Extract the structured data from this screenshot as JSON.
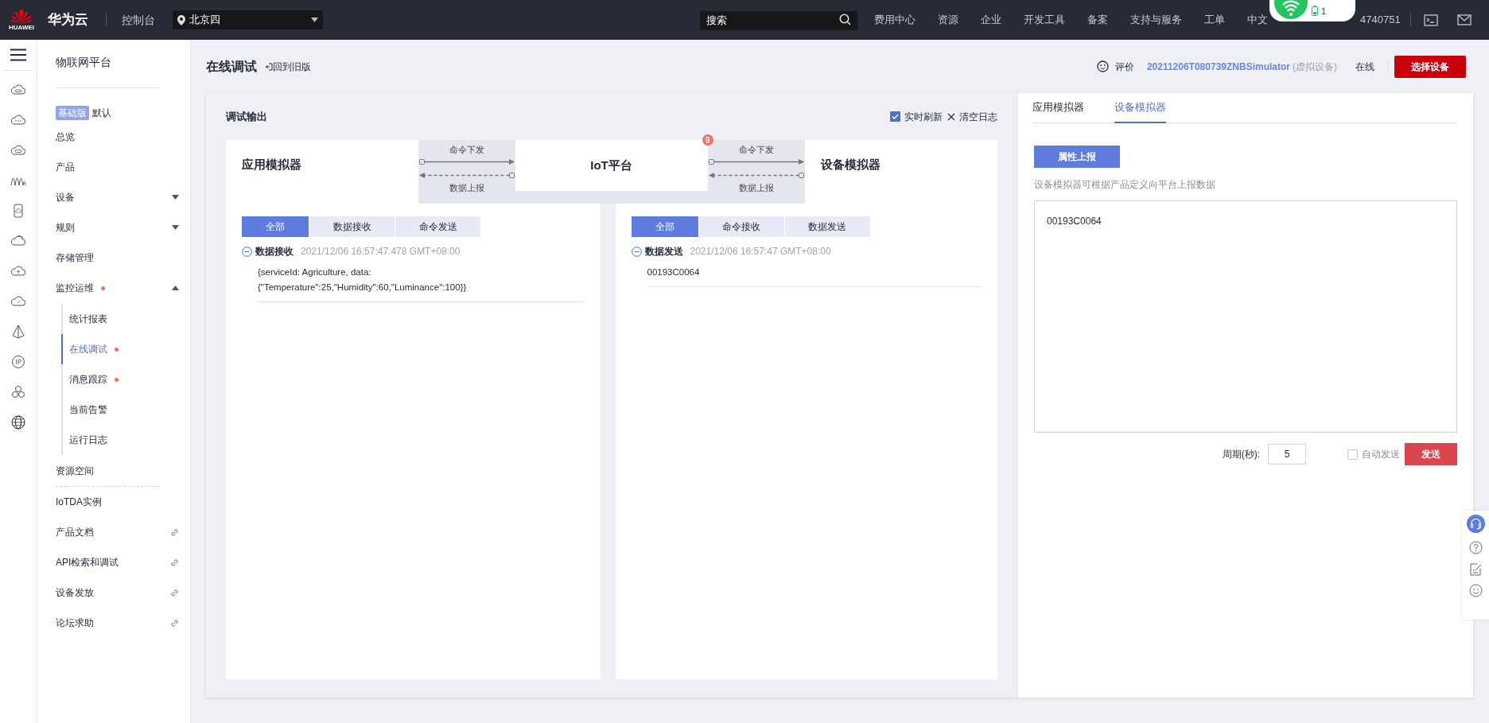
{
  "topbar": {
    "logo_text": "HUAWEI",
    "brand": "华为云",
    "console": "控制台",
    "region": "北京四",
    "search": {
      "placeholder": "搜索"
    },
    "nav": [
      "费用中心",
      "资源",
      "企业",
      "开发工具",
      "备案",
      "支持与服务",
      "工单",
      "中文"
    ],
    "account": "4740751"
  },
  "popup": {
    "count": "1"
  },
  "sidebar": {
    "title": "物联网平台",
    "edition_badge": "基础版",
    "instance": "默认",
    "items": [
      {
        "label": "总览",
        "kind": "item",
        "alert": false,
        "selected": false
      },
      {
        "label": "产品",
        "kind": "item",
        "alert": false,
        "selected": false
      },
      {
        "label": "设备",
        "kind": "group",
        "expanded": false,
        "alert": false,
        "selected": false
      },
      {
        "label": "规则",
        "kind": "group",
        "expanded": false,
        "alert": false,
        "selected": false
      },
      {
        "label": "存储管理",
        "kind": "item",
        "alert": false,
        "selected": false
      },
      {
        "label": "监控运维",
        "kind": "group",
        "expanded": true,
        "alert": true,
        "selected": false,
        "children": [
          {
            "label": "统计报表",
            "alert": false,
            "selected": false
          },
          {
            "label": "在线调试",
            "alert": true,
            "selected": true
          },
          {
            "label": "消息跟踪",
            "alert": true,
            "selected": false
          },
          {
            "label": "当前告警",
            "alert": false,
            "selected": false
          },
          {
            "label": "运行日志",
            "alert": false,
            "selected": false
          }
        ]
      },
      {
        "label": "资源空间",
        "kind": "item",
        "alert": false,
        "selected": false
      }
    ],
    "footer_items": [
      {
        "label": "IoTDA实例",
        "kind": "item",
        "alert": false,
        "selected": false
      },
      {
        "label": "产品文档",
        "kind": "link",
        "alert": false,
        "selected": false
      },
      {
        "label": "API检索和调试",
        "kind": "link",
        "alert": false,
        "selected": false
      },
      {
        "label": "设备发放",
        "kind": "link",
        "alert": false,
        "selected": false
      },
      {
        "label": "论坛求助",
        "kind": "link",
        "alert": false,
        "selected": false
      }
    ]
  },
  "header": {
    "title": "在线调试",
    "back_link": "回到旧版",
    "rating": "评价",
    "device_name": "20211206T080739ZNBSimulator",
    "device_tag": "(虚拟设备)",
    "status": "在线",
    "select_button": "选择设备"
  },
  "debug": {
    "title": "调试输出",
    "realtime_refresh": {
      "label": "实时刷新",
      "checked": true
    },
    "clear_log": "清空日志",
    "app_simulator": "应用模拟器",
    "platform": "IoT平台",
    "platform_badge": "9",
    "device_simulator": "设备模拟器",
    "links": [
      {
        "down": "命令下发",
        "up": "数据上报"
      },
      {
        "down": "命令下发",
        "up": "数据上报"
      }
    ],
    "panels": [
      {
        "tabs": [
          {
            "label": "全部",
            "selected": true
          },
          {
            "label": "数据接收",
            "selected": false
          },
          {
            "label": "命令发送",
            "selected": false
          }
        ],
        "entries": [
          {
            "type": "数据接收",
            "time": "2021/12/06 16:57:47.478 GMT+08:00",
            "body": "{serviceId: Agriculture, data:\n{\"Temperature\":25,\"Humidity\":60,\"Luminance\":100}}"
          }
        ]
      },
      {
        "tabs": [
          {
            "label": "全部",
            "selected": true
          },
          {
            "label": "命令接收",
            "selected": false
          },
          {
            "label": "数据发送",
            "selected": false
          }
        ],
        "entries": [
          {
            "type": "数据发送",
            "time": "2021/12/06 16:57:47 GMT+08:00",
            "body": "00193C0064"
          }
        ]
      }
    ]
  },
  "simulator": {
    "tabs": [
      {
        "label": "应用模拟器",
        "selected": false
      },
      {
        "label": "设备模拟器",
        "selected": true
      }
    ],
    "report_button": "属性上报",
    "hint": "设备模拟器可根据产品定义向平台上报数据",
    "payload": "00193C0064",
    "period_label": "周期(秒):",
    "period_value": "5",
    "auto_send": {
      "label": "自动发送",
      "checked": false
    },
    "send_button": "发送"
  }
}
